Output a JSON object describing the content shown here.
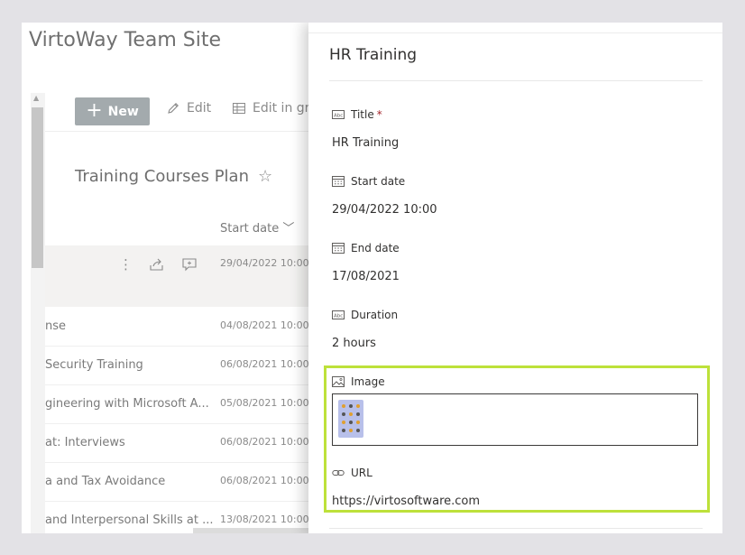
{
  "site": {
    "title": "VirtoWay Team Site"
  },
  "commandbar": {
    "new_label": "New",
    "edit_label": "Edit",
    "edit_grid_label": "Edit in gri"
  },
  "list": {
    "title": "Training Courses Plan",
    "column_start_date": "Start date",
    "selected_row": {
      "start_date": "29/04/2022 10:00"
    },
    "rows": [
      {
        "title": "nse",
        "start_date": "04/08/2021 10:00"
      },
      {
        "title": "Security Training",
        "start_date": "06/08/2021 10:00"
      },
      {
        "title": "gineering with Microsoft A...",
        "start_date": "05/08/2021 10:00"
      },
      {
        "title": "at: Interviews",
        "start_date": "06/08/2021 10:00"
      },
      {
        "title": "a and Tax Avoidance",
        "start_date": "06/08/2021 10:00"
      },
      {
        "title": "and Interpersonal Skills at ...",
        "start_date": "13/08/2021 10:00"
      }
    ]
  },
  "panel": {
    "title": "HR Training",
    "fields": {
      "title": {
        "label": "Title",
        "required_mark": "*",
        "value": "HR Training"
      },
      "start_date": {
        "label": "Start date",
        "value": "29/04/2022 10:00"
      },
      "end_date": {
        "label": "End date",
        "value": "17/08/2021"
      },
      "duration": {
        "label": "Duration",
        "value": "2 hours"
      },
      "image": {
        "label": "Image"
      },
      "url": {
        "label": "URL",
        "value": "https://virtosoftware.com"
      }
    }
  },
  "colors": {
    "highlight": "#bde13a",
    "new_button": "#a3aaad",
    "required": "#a4262c"
  }
}
